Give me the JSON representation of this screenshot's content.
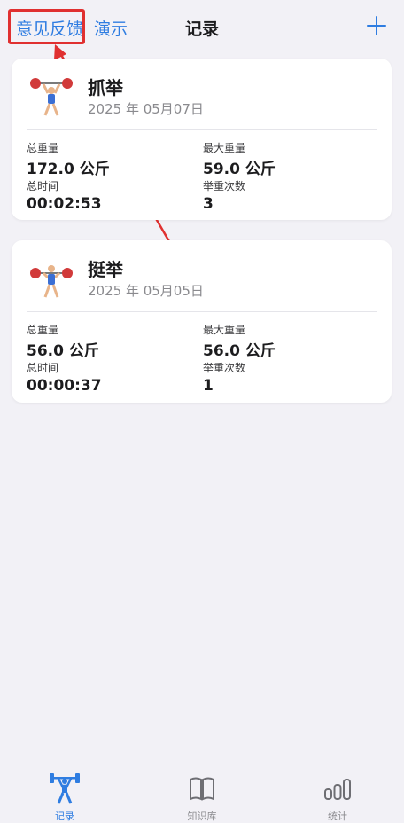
{
  "nav": {
    "feedback_label": "意见反馈",
    "demo_label": "演示",
    "title": "记录",
    "add_icon": "plus-icon"
  },
  "records": [
    {
      "name": "抓举",
      "date": "2025 年 05月07日",
      "icon": "weightlifter-icon",
      "stats": {
        "total_weight_label": "总重量",
        "total_weight": "172.0 公斤",
        "max_weight_label": "最大重量",
        "max_weight": "59.0 公斤",
        "total_time_label": "总时间",
        "total_time": "00:02:53",
        "lift_count_label": "举重次数",
        "lift_count": "3"
      }
    },
    {
      "name": "挺举",
      "date": "2025 年 05月05日",
      "icon": "weightlifter-icon",
      "stats": {
        "total_weight_label": "总重量",
        "total_weight": "56.0 公斤",
        "max_weight_label": "最大重量",
        "max_weight": "56.0 公斤",
        "total_time_label": "总时间",
        "total_time": "00:00:37",
        "lift_count_label": "举重次数",
        "lift_count": "1"
      }
    }
  ],
  "tabs": [
    {
      "label": "记录",
      "icon": "weightlifting-icon",
      "active": true
    },
    {
      "label": "知识库",
      "icon": "book-icon",
      "active": false
    },
    {
      "label": "统计",
      "icon": "bar-chart-icon",
      "active": false
    }
  ],
  "colors": {
    "accent": "#2f7de1",
    "highlight": "#e03030",
    "background": "#f2f1f6"
  }
}
